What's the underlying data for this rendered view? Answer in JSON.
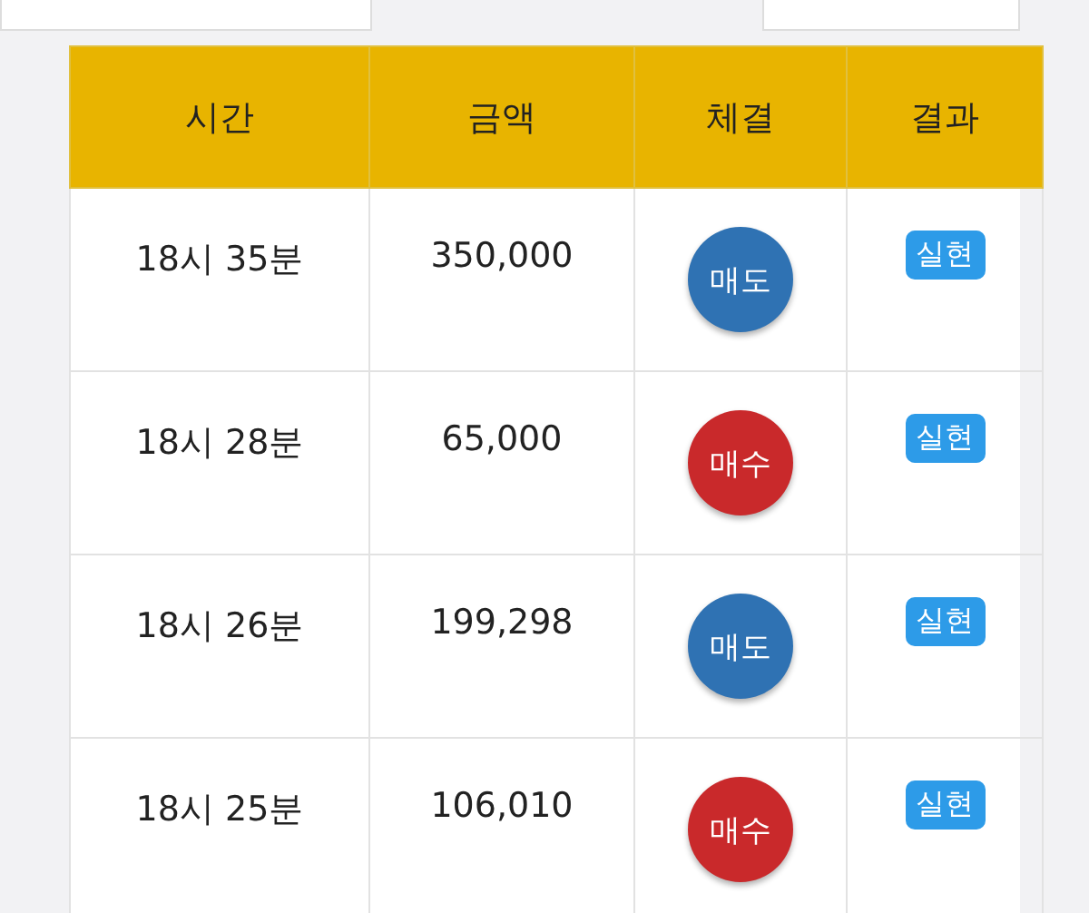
{
  "table": {
    "columns": [
      "시간",
      "금액",
      "체결",
      "결과"
    ],
    "rows": [
      {
        "time": "18시 35분",
        "amount": "350,000",
        "trade": {
          "label": "매도",
          "kind": "sell"
        },
        "result": "실현"
      },
      {
        "time": "18시 28분",
        "amount": "65,000",
        "trade": {
          "label": "매수",
          "kind": "buy"
        },
        "result": "실현"
      },
      {
        "time": "18시 26분",
        "amount": "199,298",
        "trade": {
          "label": "매도",
          "kind": "sell"
        },
        "result": "실현"
      },
      {
        "time": "18시 25분",
        "amount": "106,010",
        "trade": {
          "label": "매수",
          "kind": "buy"
        },
        "result": "실현"
      }
    ]
  }
}
